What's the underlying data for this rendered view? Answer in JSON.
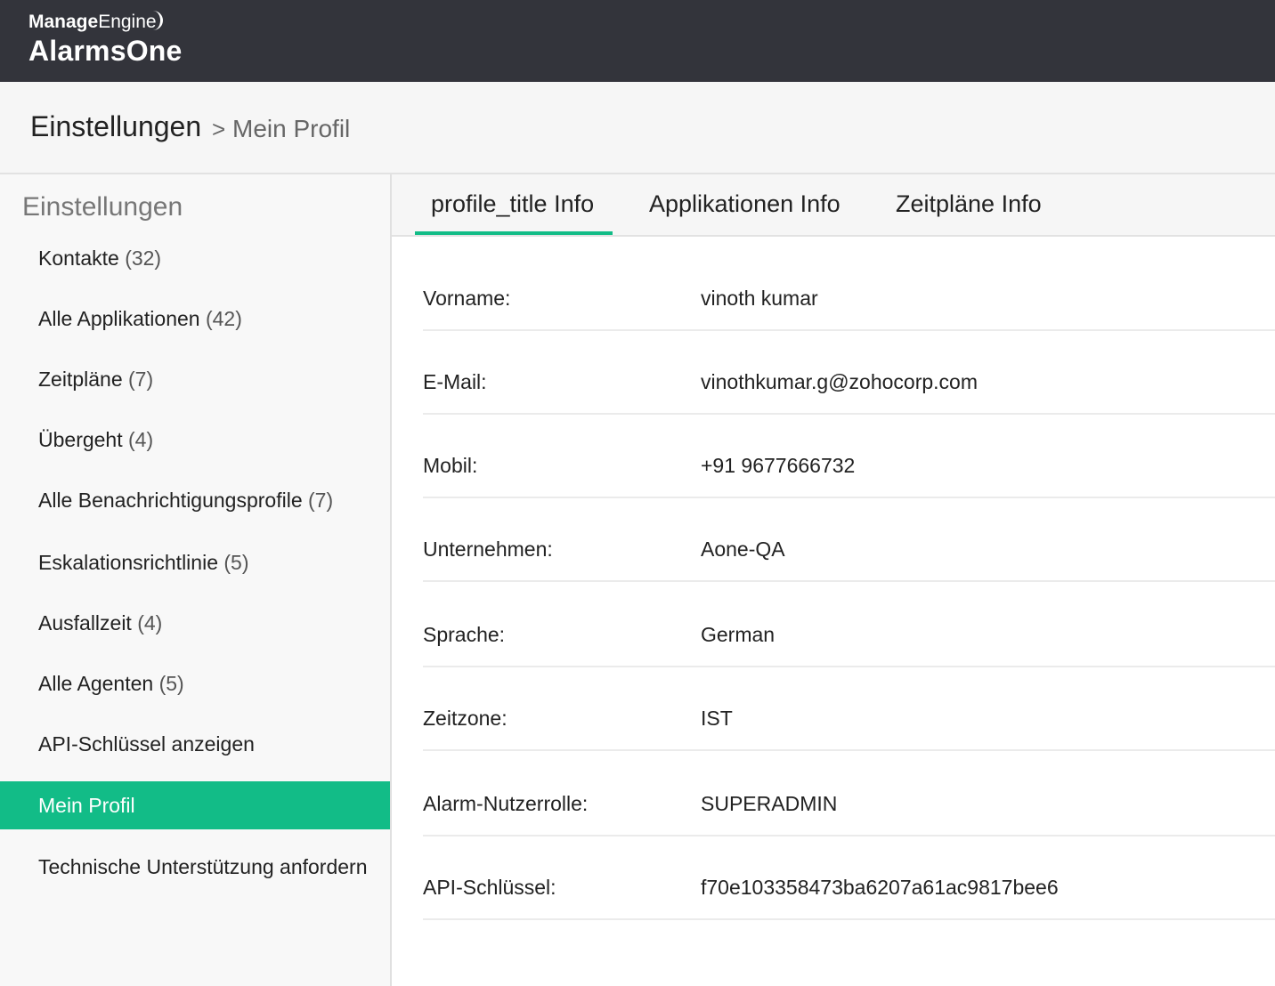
{
  "brand": {
    "company_a": "Manage",
    "company_b": "Engine",
    "product": "AlarmsOne"
  },
  "header": {
    "title": "Einstellungen",
    "separator": ">",
    "current": "Mein Profil"
  },
  "sidebar": {
    "title": "Einstellungen",
    "items": [
      {
        "label": "Kontakte",
        "count": "(32)"
      },
      {
        "label": "Alle Applikationen",
        "count": "(42)"
      },
      {
        "label": "Zeitpläne",
        "count": "(7)"
      },
      {
        "label": "Übergeht",
        "count": "(4)"
      },
      {
        "label": "Alle Benachrichtigungsprofile",
        "count": "(7)"
      },
      {
        "label": "Eskalationsrichtlinie",
        "count": "(5)"
      },
      {
        "label": "Ausfallzeit",
        "count": "(4)"
      },
      {
        "label": "Alle Agenten",
        "count": "(5)"
      },
      {
        "label": "API-Schlüssel anzeigen",
        "count": ""
      },
      {
        "label": "Mein Profil",
        "count": ""
      },
      {
        "label": "Technische Unterstützung anfordern",
        "count": ""
      }
    ],
    "active_index": 9
  },
  "tabs": [
    {
      "label": "profile_title Info"
    },
    {
      "label": "Applikationen Info"
    },
    {
      "label": "Zeitpläne Info"
    }
  ],
  "profile": {
    "rows": [
      {
        "label": "Vorname:",
        "value": "vinoth kumar"
      },
      {
        "label": "E-Mail:",
        "value": "vinothkumar.g@zohocorp.com"
      },
      {
        "label": "Mobil:",
        "value": "+91 9677666732"
      },
      {
        "label": "Unternehmen:",
        "value": "Aone-QA"
      },
      {
        "label": "Sprache:",
        "value": "German"
      },
      {
        "label": "Zeitzone:",
        "value": "IST"
      },
      {
        "label": "Alarm-Nutzerrolle:",
        "value": "SUPERADMIN"
      },
      {
        "label": "API-Schlüssel:",
        "value": "f70e103358473ba6207a61ac9817bee6"
      }
    ]
  },
  "colors": {
    "topbar": "#33343b",
    "accent": "#12bc87"
  }
}
